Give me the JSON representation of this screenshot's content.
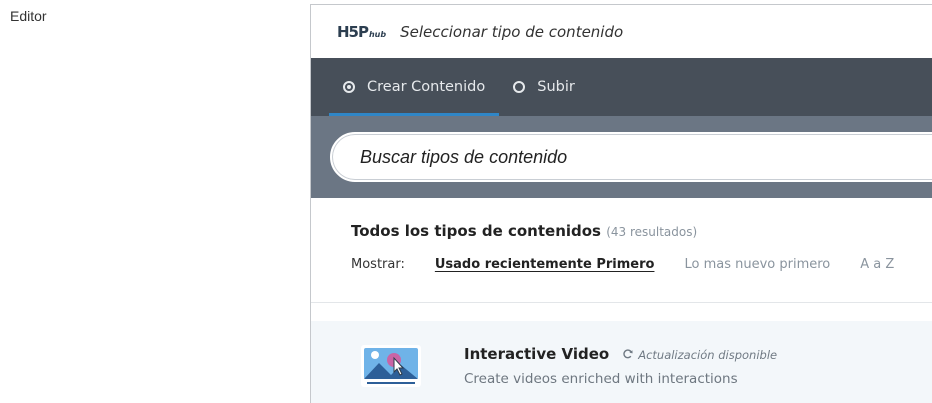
{
  "page": {
    "editor_label": "Editor"
  },
  "hub": {
    "logo_main": "H5P",
    "logo_sub": "hub",
    "title": "Seleccionar tipo de contenido"
  },
  "tabs": [
    {
      "label": "Crear Contenido",
      "selected": true
    },
    {
      "label": "Subir",
      "selected": false
    }
  ],
  "search": {
    "placeholder": "Buscar tipos de contenido",
    "value": ""
  },
  "results": {
    "title": "Todos los tipos de contenidos",
    "count": "(43 resultados)",
    "sort_label": "Mostrar:",
    "sort_options": [
      {
        "label": "Usado recientemente Primero",
        "active": true
      },
      {
        "label": "Lo mas nuevo primero",
        "active": false
      },
      {
        "label": "A a Z",
        "active": false
      }
    ]
  },
  "items": [
    {
      "icon": "interactive-video-icon",
      "title": "Interactive Video",
      "update_text": "Actualización disponible",
      "description": "Create videos enriched with interactions"
    }
  ],
  "colors": {
    "tab_bar": "#474f59",
    "search_band": "#6b7684",
    "active_underline": "#2f86c7",
    "list_bg": "#f3f7fa"
  }
}
